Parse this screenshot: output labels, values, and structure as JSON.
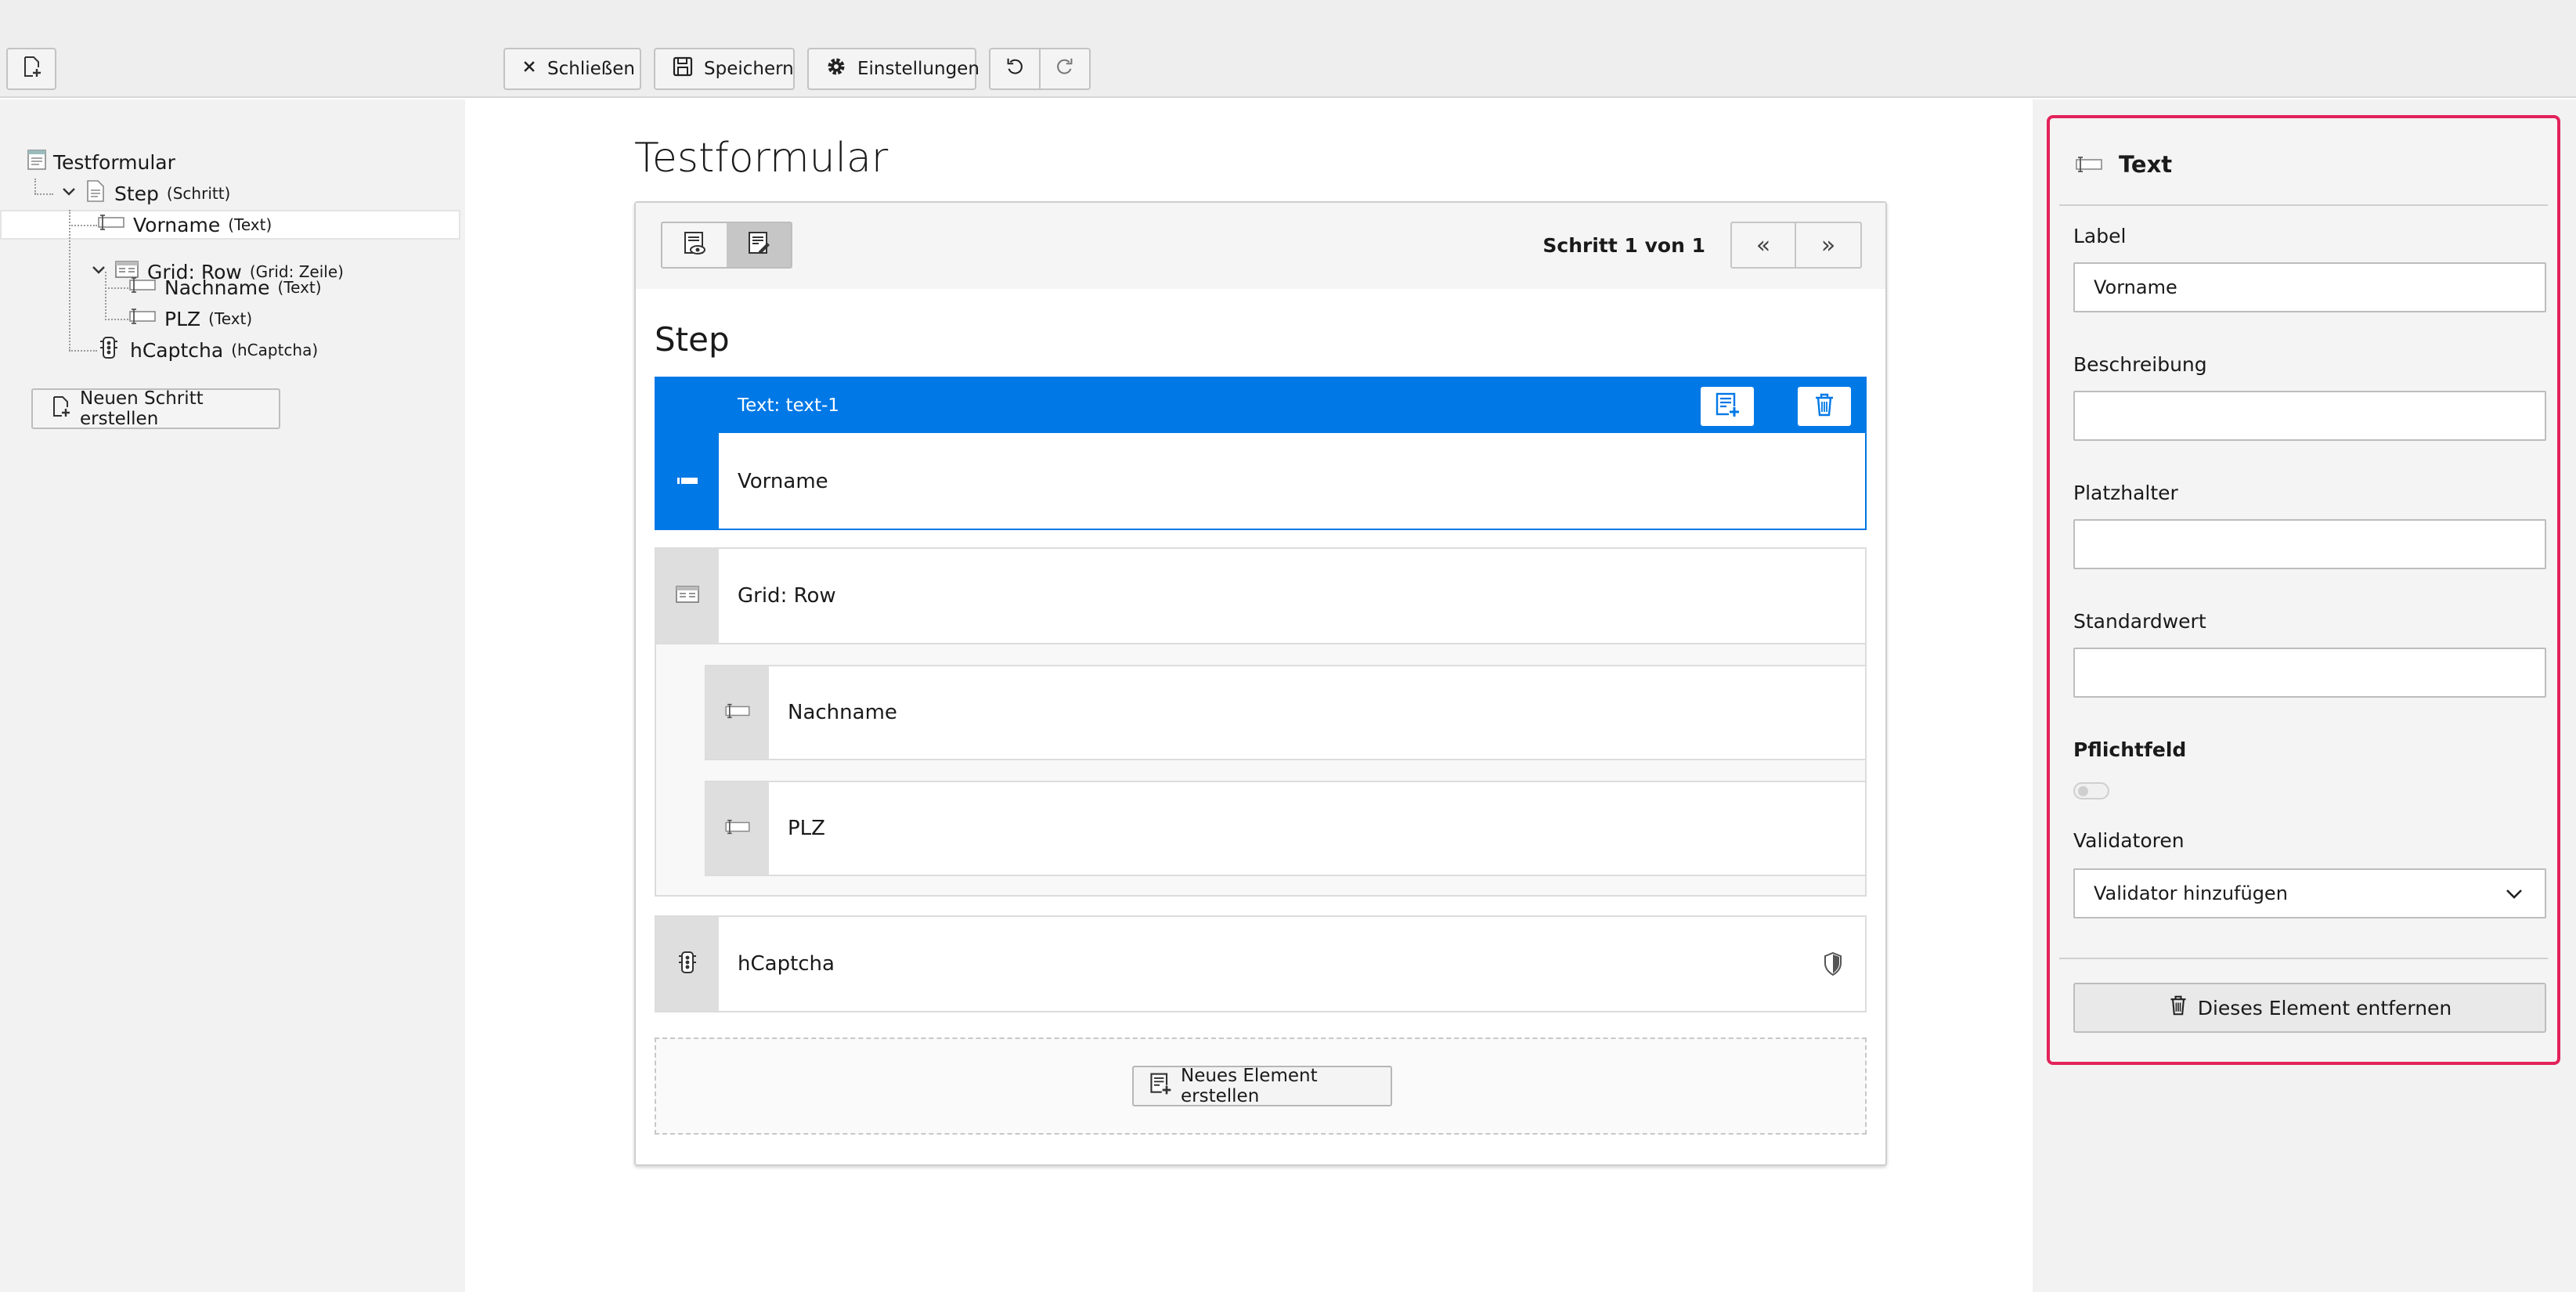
{
  "toolbar": {
    "new_form_icon": "new-document-icon",
    "close_label": "Schließen",
    "save_label": "Speichern",
    "settings_label": "Einstellungen"
  },
  "tree": {
    "items": [
      {
        "label": "Testformular",
        "type": ""
      },
      {
        "label": "Step",
        "type": "(Schritt)"
      },
      {
        "label": "Vorname",
        "type": "(Text)"
      },
      {
        "label": "Grid: Row",
        "type": "(Grid: Zeile)"
      },
      {
        "label": "Nachname",
        "type": "(Text)"
      },
      {
        "label": "PLZ",
        "type": "(Text)"
      },
      {
        "label": "hCaptcha",
        "type": "(hCaptcha)"
      }
    ],
    "new_step_label": "Neuen Schritt erstellen"
  },
  "stage": {
    "form_title": "Testformular",
    "step_indicator": "Schritt 1 von 1",
    "pager_prev": "«",
    "pager_next": "»",
    "step_title": "Step",
    "selected": {
      "header": "Text: text-1",
      "label": "Vorname"
    },
    "grid_label": "Grid: Row",
    "nachname_label": "Nachname",
    "plz_label": "PLZ",
    "hcaptcha_label": "hCaptcha",
    "new_element_label": "Neues Element erstellen"
  },
  "inspector": {
    "title": "Text",
    "label_caption": "Label",
    "label_value": "Vorname",
    "description_caption": "Beschreibung",
    "description_value": "",
    "placeholder_caption": "Platzhalter",
    "placeholder_value": "",
    "default_caption": "Standardwert",
    "default_value": "",
    "required_caption": "Pflichtfeld",
    "required": false,
    "validators_caption": "Validatoren",
    "validator_select": "Validator hinzufügen",
    "remove_label": "Dieses Element entfernen"
  },
  "colors": {
    "accent": "#0078e6",
    "inspector_border": "#e3225a"
  }
}
